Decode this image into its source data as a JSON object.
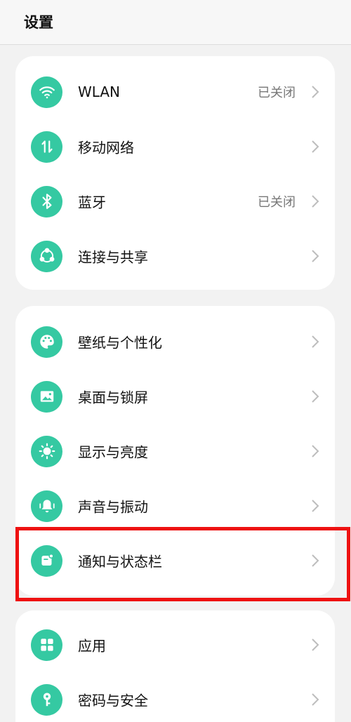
{
  "header": {
    "title": "设置"
  },
  "colors": {
    "accent": "#35c9a2",
    "highlight": "#ee1111",
    "chevron": "#bdbdbd"
  },
  "groups": [
    {
      "items": [
        {
          "label": "WLAN",
          "value": "已关闭",
          "icon": "wifi-icon"
        },
        {
          "label": "移动网络",
          "value": "",
          "icon": "mobile-data-icon"
        },
        {
          "label": "蓝牙",
          "value": "已关闭",
          "icon": "bluetooth-icon"
        },
        {
          "label": "连接与共享",
          "value": "",
          "icon": "share-icon"
        }
      ]
    },
    {
      "items": [
        {
          "label": "壁纸与个性化",
          "value": "",
          "icon": "palette-icon"
        },
        {
          "label": "桌面与锁屏",
          "value": "",
          "icon": "image-icon"
        },
        {
          "label": "显示与亮度",
          "value": "",
          "icon": "brightness-icon"
        },
        {
          "label": "声音与振动",
          "value": "",
          "icon": "bell-icon"
        },
        {
          "label": "通知与状态栏",
          "value": "",
          "icon": "notification-icon"
        }
      ]
    },
    {
      "items": [
        {
          "label": "应用",
          "value": "",
          "icon": "apps-icon"
        },
        {
          "label": "密码与安全",
          "value": "",
          "icon": "key-icon"
        }
      ]
    }
  ]
}
